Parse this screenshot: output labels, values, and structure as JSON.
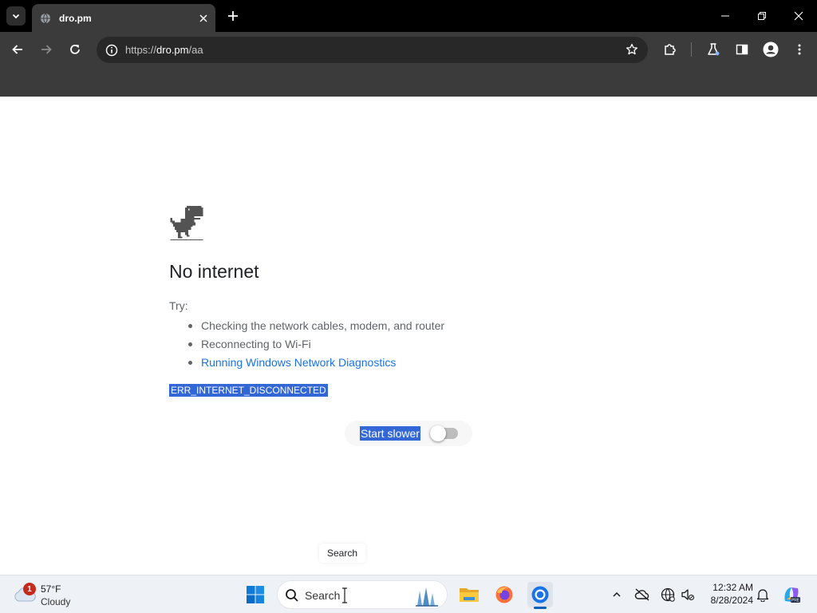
{
  "browser": {
    "tab_title": "dro.pm",
    "url_scheme": "https://",
    "url_host": "dro.pm",
    "url_path": "/aa"
  },
  "page": {
    "heading": "No internet",
    "try_label": "Try:",
    "suggestions": [
      "Checking the network cables, modem, and router",
      "Reconnecting to Wi-Fi",
      "Running Windows Network Diagnostics"
    ],
    "error_code": "ERR_INTERNET_DISCONNECTED",
    "start_slower_label": "Start slower",
    "start_slower_enabled": false,
    "tooltip": "Search"
  },
  "taskbar": {
    "weather_temp": "57°F",
    "weather_condition": "Cloudy",
    "weather_badge": "1",
    "search_placeholder": "Search",
    "clock_time": "12:32 AM",
    "clock_date": "8/28/2024",
    "pinned_apps": [
      "start-icon",
      "file-explorer-icon",
      "firefox-icon",
      "chrome-icon"
    ]
  },
  "colors": {
    "link": "#1a73e8",
    "selection": "#3367d6",
    "text": "#202124",
    "taskbar_accent": "#005fb8"
  }
}
